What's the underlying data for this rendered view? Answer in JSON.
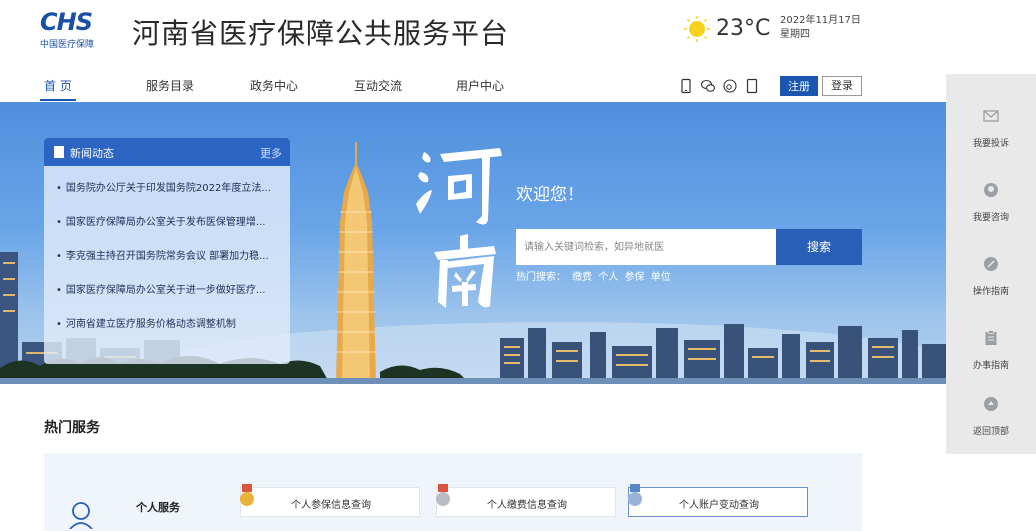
{
  "header": {
    "logo_mark": "CHS",
    "logo_sub": "中国医疗保障",
    "site_title": "河南省医疗保障公共服务平台",
    "weather": {
      "temperature": "23°C",
      "date": "2022年11月17日",
      "weekday": "星期四",
      "icon": "sun-icon"
    }
  },
  "nav": {
    "items": [
      {
        "label": "首  页",
        "active": true
      },
      {
        "label": "服务目录"
      },
      {
        "label": "政务中心"
      },
      {
        "label": "互动交流"
      },
      {
        "label": "用户中心"
      }
    ],
    "icons": [
      "mobile-icon",
      "wechat-icon",
      "weibo-icon",
      "tablet-icon"
    ],
    "register_label": "注册",
    "login_label": "登录"
  },
  "hero": {
    "news": {
      "title": "新闻动态",
      "more": "更多",
      "items": [
        "国务院办公厅关于印发国务院2022年度立法...",
        "国家医疗保障局办公室关于发布医保管理增...",
        "李克强主持召开国务院常务会议 部署加力稳...",
        "国家医疗保障局办公室关于进一步做好医疗...",
        "河南省建立医疗服务价格动态调整机制"
      ]
    },
    "welcome": "欢迎您！",
    "search": {
      "placeholder": "请输入关键词检索，如异地就医",
      "button": "搜索",
      "hot_label": "热门搜索：",
      "hot_keywords": [
        "缴费",
        "个人",
        "参保",
        "单位"
      ]
    }
  },
  "float_bar": {
    "items": [
      {
        "label": "我要投诉",
        "icon": "mail-icon"
      },
      {
        "label": "我要咨询",
        "icon": "headset-icon"
      },
      {
        "label": "操作指南",
        "icon": "compass-icon"
      },
      {
        "label": "办事指南",
        "icon": "clipboard-icon"
      },
      {
        "label": "返回顶部",
        "icon": "arrow-up-icon"
      }
    ]
  },
  "services": {
    "title": "热门服务",
    "category": "个人服务",
    "cards": [
      {
        "label": "个人参保信息查询",
        "medal": "gold"
      },
      {
        "label": "个人缴费信息查询",
        "medal": "silver"
      },
      {
        "label": "个人账户变动查询",
        "medal": "bronze"
      }
    ]
  },
  "colors": {
    "brand_blue": "#1a56b0",
    "nav_active": "#1a56b0",
    "search_button": "#2a5fb8"
  }
}
